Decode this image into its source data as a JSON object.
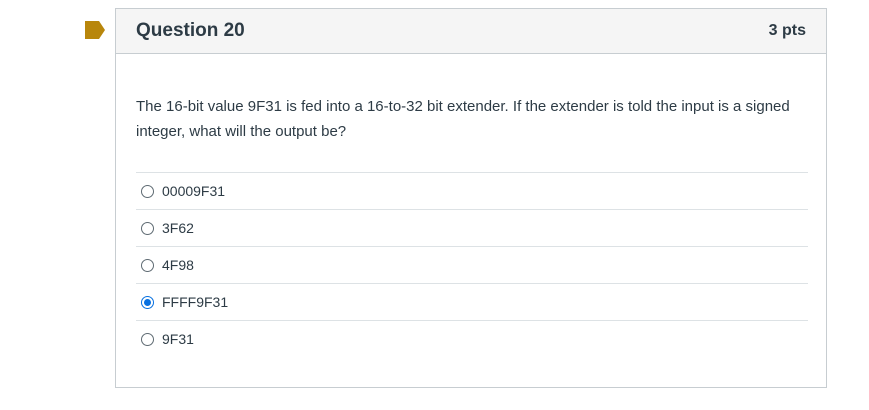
{
  "question": {
    "title": "Question 20",
    "points": "3 pts",
    "text": "The 16-bit value 9F31 is fed into a 16-to-32 bit extender.  If the extender is told the input is a signed integer, what will the output be?",
    "flag_color": "#b8860b",
    "answers": [
      {
        "label": "00009F31",
        "selected": false
      },
      {
        "label": "3F62",
        "selected": false
      },
      {
        "label": "4F98",
        "selected": false
      },
      {
        "label": "FFFF9F31",
        "selected": true
      },
      {
        "label": "9F31",
        "selected": false
      }
    ]
  },
  "colors": {
    "accent": "#0770e0",
    "header_bg": "#f5f5f5",
    "border": "#c7cdd1"
  }
}
